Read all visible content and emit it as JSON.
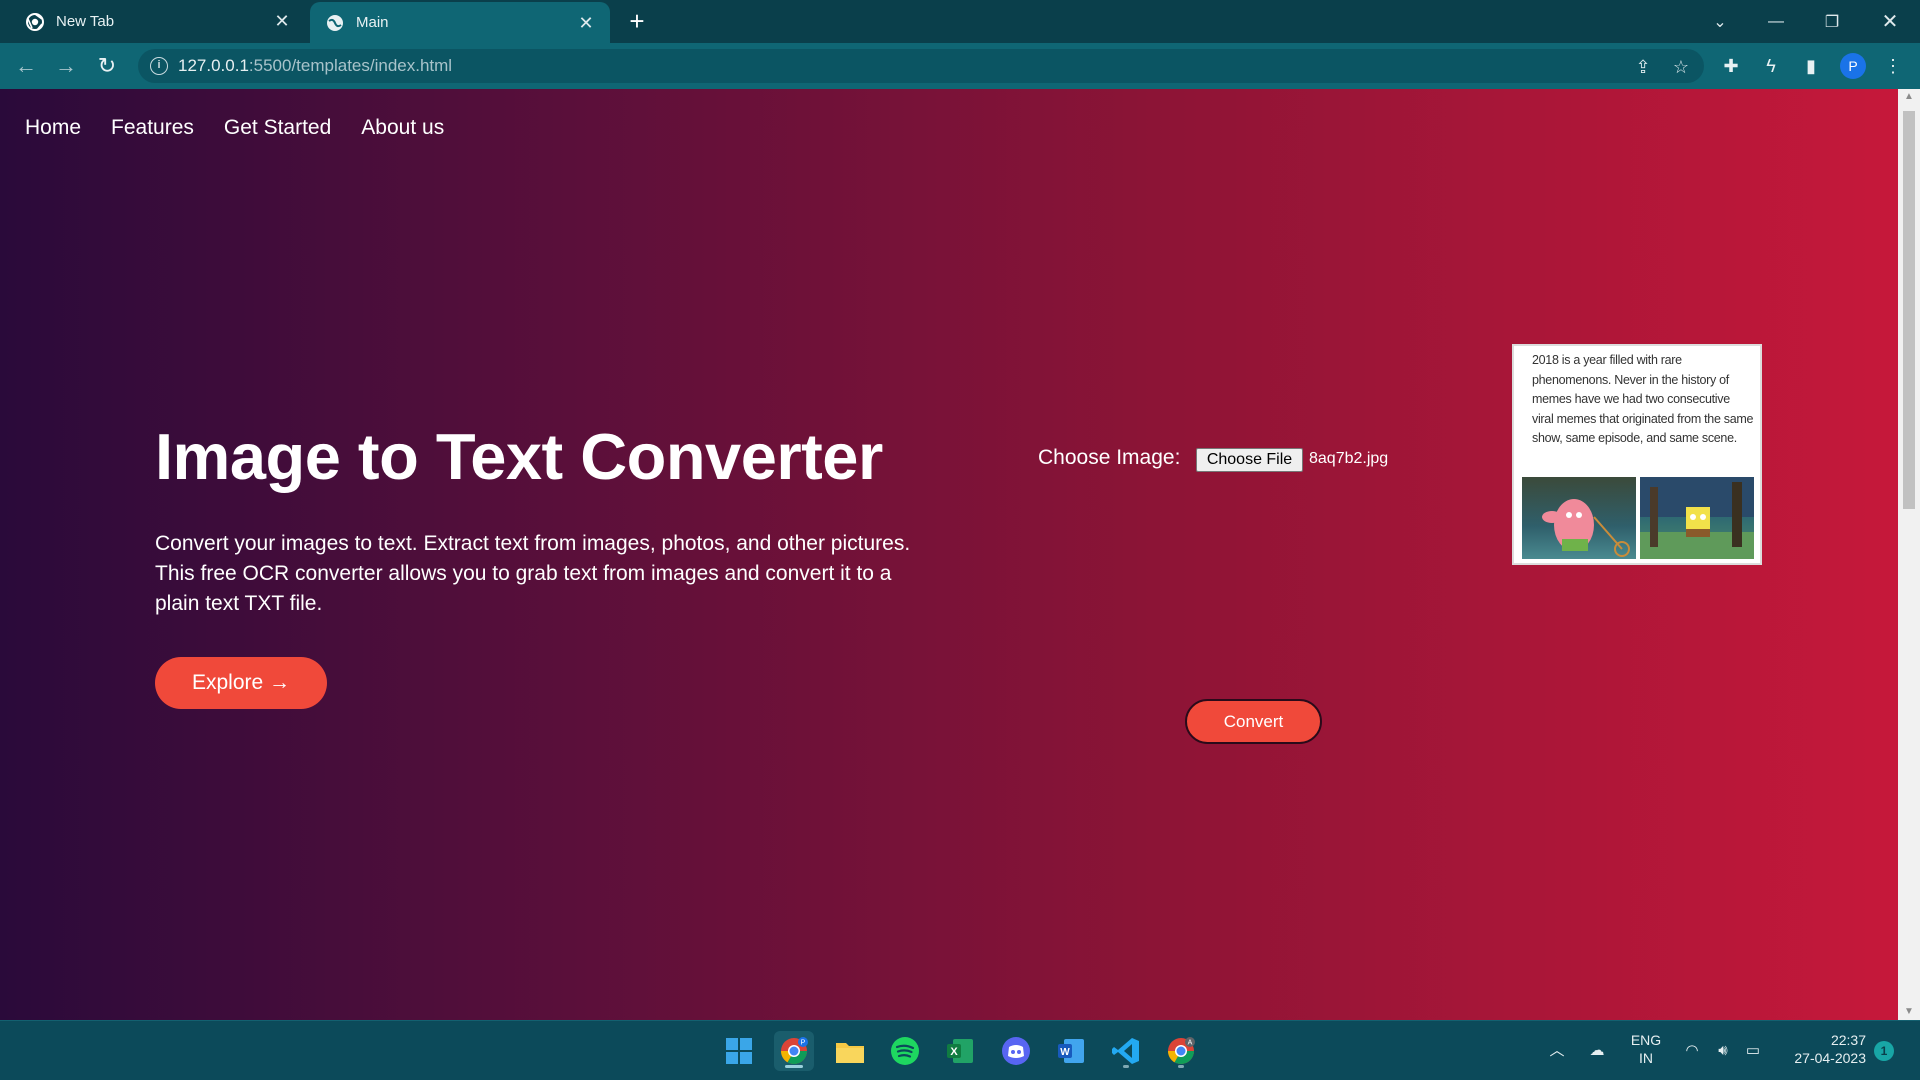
{
  "browser": {
    "tabs": [
      {
        "title": "New Tab",
        "active": false
      },
      {
        "title": "Main",
        "active": true
      }
    ],
    "url_host": "127.0.0.1",
    "url_rest": ":5500/templates/index.html",
    "profile_initial": "P"
  },
  "nav": {
    "items": [
      "Home",
      "Features",
      "Get Started",
      "About us"
    ]
  },
  "hero": {
    "title": "Image to Text Converter",
    "description": "Convert your images to text. Extract text from images, photos, and other pictures. This free OCR converter allows you to grab text from images and convert it to a plain text TXT file.",
    "explore_label": "Explore →"
  },
  "upload": {
    "label": "Choose Image:",
    "file_button": "Choose File",
    "file_name": "8aq7b2.jpg",
    "preview_text": "2018 is a year filled with rare phenomenons. Never in the history of memes have we had two consecutive viral memes that originated from the same show, same episode, and same scene.",
    "convert_label": "Convert"
  },
  "taskbar": {
    "apps": [
      "windows-start",
      "chrome-profile-p",
      "file-explorer",
      "spotify",
      "excel",
      "discord",
      "word",
      "vscode",
      "chrome-profile-a"
    ],
    "lang_top": "ENG",
    "lang_bottom": "IN",
    "time": "22:37",
    "date": "27-04-2023",
    "notification_count": "1"
  },
  "colors": {
    "accent": "#f0493a",
    "chrome_bg": "#0a3f4b",
    "toolbar_bg": "#0f6674"
  }
}
